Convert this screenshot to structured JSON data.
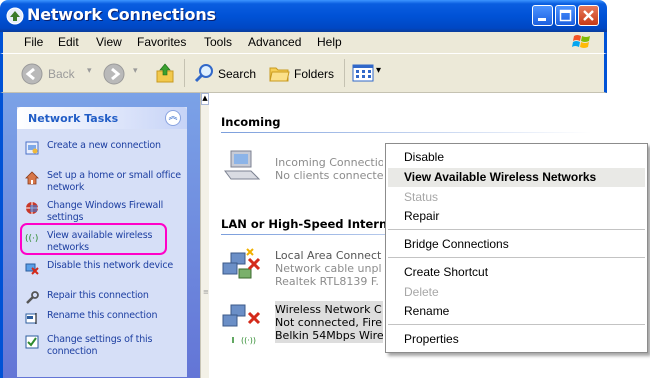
{
  "window": {
    "title": "Network Connections"
  },
  "menu": {
    "items": [
      "File",
      "Edit",
      "View",
      "Favorites",
      "Tools",
      "Advanced",
      "Help"
    ]
  },
  "toolbar": {
    "back_label": "Back",
    "search_label": "Search",
    "folders_label": "Folders"
  },
  "left_panel": {
    "title": "Network Tasks",
    "tasks": [
      {
        "label": "Create a new connection",
        "icon": "create-connection-icon"
      },
      {
        "label": "Set up a home or small office network",
        "icon": "home-network-icon"
      },
      {
        "label": "Change Windows Firewall settings",
        "icon": "firewall-icon"
      },
      {
        "label": "View available wireless networks",
        "icon": "wireless-icon"
      },
      {
        "label": "Disable this network device",
        "icon": "disable-device-icon"
      },
      {
        "label": "Repair this connection",
        "icon": "repair-icon"
      },
      {
        "label": "Rename this connection",
        "icon": "rename-icon"
      },
      {
        "label": "Change settings of this connection",
        "icon": "settings-icon"
      }
    ],
    "highlight_color": "#ff00c8"
  },
  "content": {
    "sections": [
      {
        "title": "Incoming",
        "items": [
          {
            "lines": [
              "Incoming Connectio",
              "No clients connecte"
            ]
          }
        ]
      },
      {
        "title": "LAN or High-Speed Intern",
        "items": [
          {
            "lines": [
              "Local Area Connect",
              "Network cable unpl",
              "Realtek RTL8139 F."
            ]
          },
          {
            "lines": [
              "Wireless Network C",
              "Not connected, Fire",
              "Belkin 54Mbps Wire"
            ]
          }
        ]
      }
    ]
  },
  "context_menu": {
    "groups": [
      [
        {
          "label": "Disable",
          "state": "normal"
        },
        {
          "label": "View Available Wireless Networks",
          "state": "default-highlighted"
        },
        {
          "label": "Status",
          "state": "disabled"
        },
        {
          "label": "Repair",
          "state": "normal"
        }
      ],
      [
        {
          "label": "Bridge Connections",
          "state": "normal"
        }
      ],
      [
        {
          "label": "Create Shortcut",
          "state": "normal"
        },
        {
          "label": "Delete",
          "state": "disabled"
        },
        {
          "label": "Rename",
          "state": "normal"
        }
      ],
      [
        {
          "label": "Properties",
          "state": "normal"
        }
      ]
    ]
  }
}
